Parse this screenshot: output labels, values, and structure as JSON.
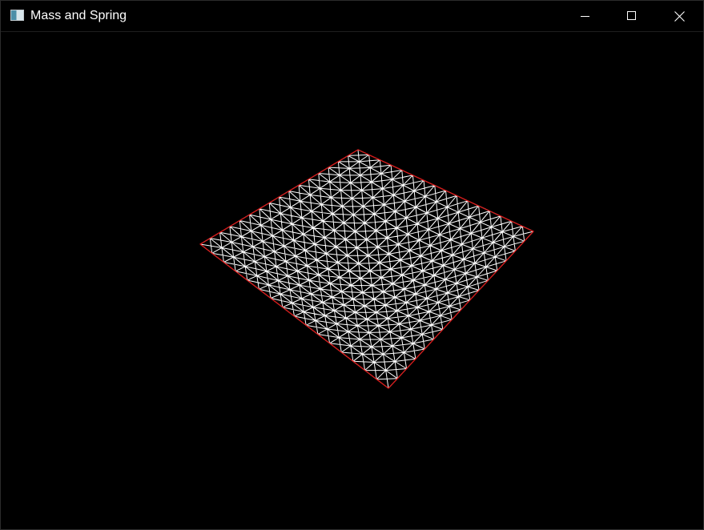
{
  "window": {
    "title": "Mass and Spring",
    "app_icon": "window-app-icon",
    "controls": {
      "minimize_icon": "minimize-icon",
      "maximize_icon": "maximize-icon",
      "close_icon": "close-icon"
    }
  },
  "scene": {
    "description_icon": "cloth-mesh",
    "grid_resolution": 16,
    "background_color": "#000000",
    "mesh_color": "#ffffff",
    "border_color": "#dd1111"
  }
}
